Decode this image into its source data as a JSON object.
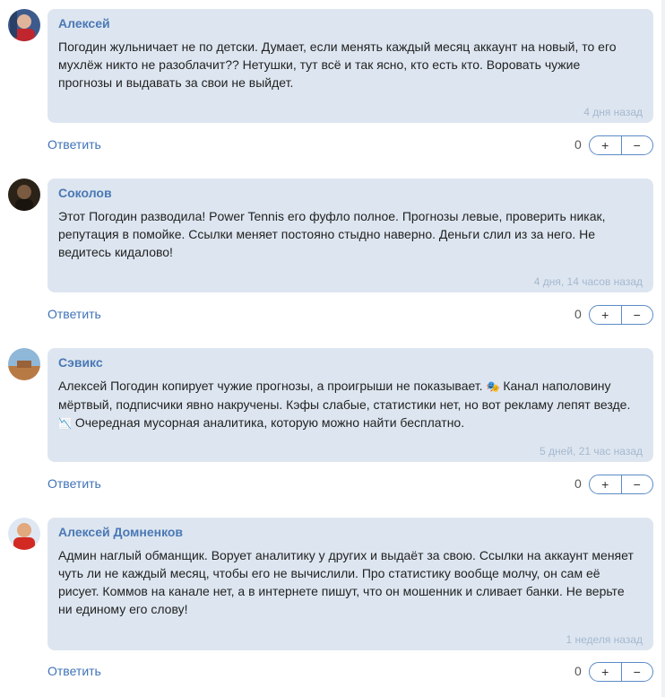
{
  "reply_label": "Ответить",
  "comments": [
    {
      "author": "Алексей",
      "text": "Погодин жульничает не по детски. Думает, если менять каждый месяц аккаунт на новый, то его мухлёж никто не разоблачит?? Нетушки, тут всё и так ясно, кто есть кто. Воровать чужие прогнозы и выдавать за свои не выйдет.",
      "time": "4 дня назад",
      "score": "0",
      "up": "+",
      "down": "−"
    },
    {
      "author": "Соколов",
      "text": "Этот Погодин разводила! Power Tennis его фуфло полное. Прогнозы левые, проверить никак, репутация в помойке. Ссылки меняет постояно стыдно наверно. Деньги слил из за него. Не ведитесь кидалово!",
      "time": "4 дня, 14 часов назад",
      "score": "0",
      "up": "+",
      "down": "−"
    },
    {
      "author": "Сэвикс",
      "text_part1": "Алексей Погодин копирует чужие прогнозы, а проигрыши не показывает.",
      "text_part2": "Канал наполовину мёртвый, подписчики явно накручены. Кэфы слабые, статистики нет, но вот рекламу лепят везде.",
      "text_part3": "Очередная мусорная аналитика, которую можно найти бесплатно.",
      "emoji1": "🎭",
      "emoji2": "📉",
      "time": "5 дней, 21 час назад",
      "score": "0",
      "up": "+",
      "down": "−"
    },
    {
      "author": "Алексей Домненков",
      "text": "Админ наглый обманщик. Ворует аналитику у других и выдаёт за свою. Ссылки на аккаунт меняет чуть ли не каждый месяц, чтобы его не вычислили. Про статистику вообще молчу, он сам её рисует. Коммов на канале нет, а в интернете пишут, что он мошенник и сливает банки. Не верьте ни единому его слову!",
      "time": "1 неделя назад",
      "score": "0",
      "up": "+",
      "down": "−"
    }
  ]
}
